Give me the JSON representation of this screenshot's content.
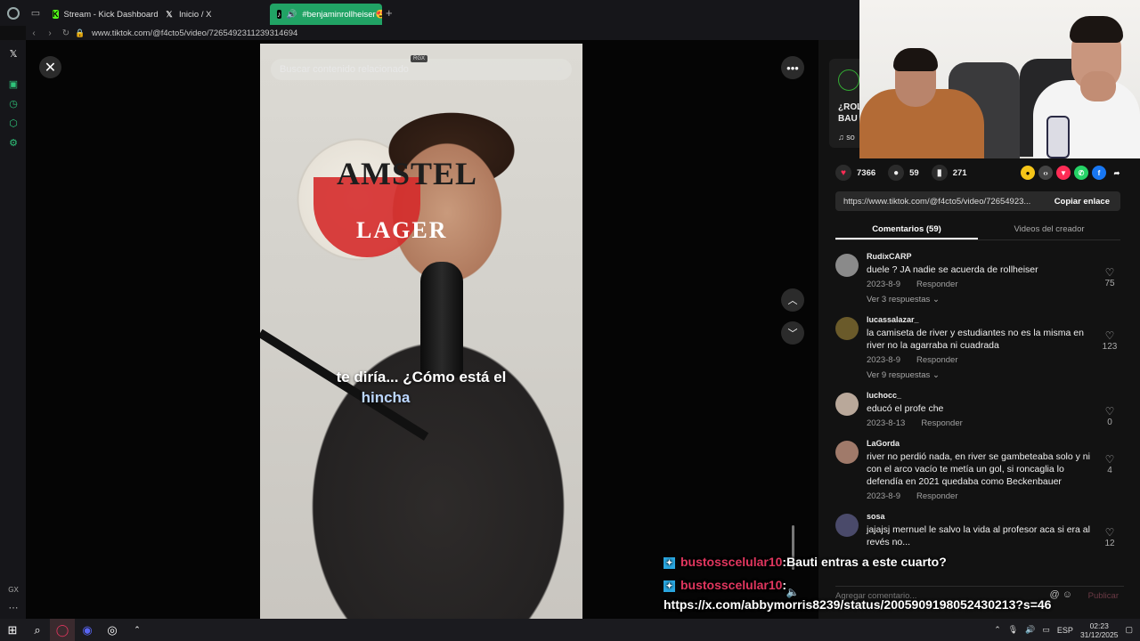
{
  "browser": {
    "tabs": [
      {
        "label": "Stream - Kick Dashboard",
        "icon": "kick-icon"
      },
      {
        "label": "Inicio / X",
        "icon": "x-icon"
      },
      {
        "label": "#benjaminrollheiser😍",
        "icon": "tiktok-icon"
      }
    ],
    "url": "www.tiktok.com/@f4cto5/video/7265492311239314694"
  },
  "video": {
    "search_placeholder": "Buscar contenido relacionado",
    "watermark_badge": "RGX",
    "beer_brand": "AMSTEL",
    "beer_sub": "LAGER",
    "caption_line1": "te diría... ¿Cómo está el",
    "caption_highlight": "hincha"
  },
  "creator": {
    "desc_line1": "¿ROL",
    "desc_line2": "BAU",
    "sound_prefix": "♫ so"
  },
  "stats": {
    "likes": "7366",
    "comments": "59",
    "saves": "271"
  },
  "link": {
    "url": "https://www.tiktok.com/@f4cto5/video/72654923...",
    "copy_label": "Copiar enlace"
  },
  "panel_tabs": {
    "comments": "Comentarios (59)",
    "creator_videos": "Videos del creador"
  },
  "comments": [
    {
      "user": "RudixCARP",
      "text": "duele ? JA nadie se acuerda de rollheiser",
      "date": "2023-8-9",
      "reply": "Responder",
      "likes": "75",
      "replies": "Ver 3 respuestas",
      "avatar_color": "#8a8a8a"
    },
    {
      "user": "lucassalazar_",
      "text": "la camiseta de river y estudiantes no es la misma en river no la agarraba ni cuadrada",
      "date": "2023-8-9",
      "reply": "Responder",
      "likes": "123",
      "replies": "Ver 9 respuestas",
      "avatar_color": "#6a5a2a"
    },
    {
      "user": "luchocc_",
      "text": "educó el profe che",
      "date": "2023-8-13",
      "reply": "Responder",
      "likes": "0",
      "replies": "",
      "avatar_color": "#b9a89a"
    },
    {
      "user": "LaGorda",
      "text": "river no perdió nada, en river se gambeteaba solo y ni con el arco vacío te metía un gol, si roncaglia lo defendía en 2021 quedaba como Beckenbauer",
      "date": "2023-8-9",
      "reply": "Responder",
      "likes": "4",
      "replies": "",
      "avatar_color": "#a07a6a"
    },
    {
      "user": "sosa",
      "text": "jajajsj mernuel le salvo la vida al profesor aca si era al revés no...",
      "date": "",
      "reply": "",
      "likes": "12",
      "replies": "",
      "avatar_color": "#4a4a6a"
    }
  ],
  "comment_input": {
    "placeholder": "Agregar comentario...",
    "publish": "Publicar"
  },
  "chat": [
    {
      "user": "bustosscelular10",
      "sep": ":",
      "message": "Bauti entras a este cuarto?"
    },
    {
      "user": "bustosscelular10",
      "sep": ":",
      "message": ""
    }
  ],
  "chat_link": "https://x.com/abbymorris8239/status/2005909198052430213?s=46",
  "taskbar": {
    "lang": "ESP",
    "time": "02:23",
    "date": "31/12/2025"
  },
  "colors": {
    "accent_green": "#21a365",
    "tiktok_red": "#fe2c55",
    "chat_user": "#e0365e"
  }
}
